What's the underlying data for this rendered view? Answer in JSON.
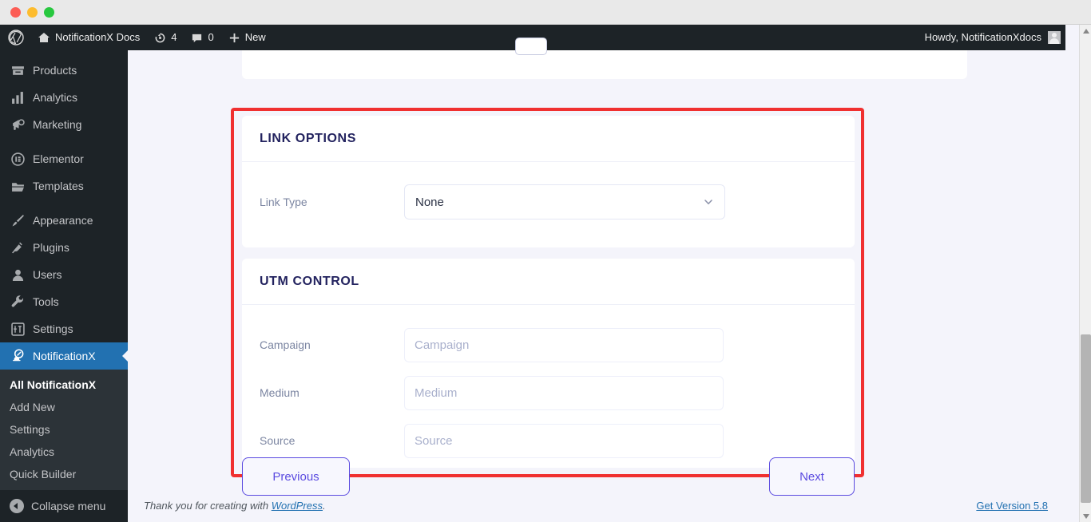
{
  "window": {
    "traffic_lights": [
      "close",
      "minimize",
      "maximize"
    ]
  },
  "adminbar": {
    "logo_icon": "wordpress-logo-icon",
    "site_icon": "home-icon",
    "site_name": "NotificationX Docs",
    "updates_icon": "updates-icon",
    "updates_count": "4",
    "comments_icon": "comment-bubble-icon",
    "comments_count": "0",
    "new_icon": "plus-icon",
    "new_label": "New",
    "howdy": "Howdy, NotificationXdocs",
    "avatar_icon": "user-avatar-icon"
  },
  "sidebar": {
    "items": [
      {
        "label": "Products",
        "icon": "products-icon",
        "active": false
      },
      {
        "label": "Analytics",
        "icon": "chart-bars-icon",
        "active": false
      },
      {
        "label": "Marketing",
        "icon": "megaphone-icon",
        "active": false
      },
      {
        "label": "Elementor",
        "icon": "elementor-icon",
        "active": false
      },
      {
        "label": "Templates",
        "icon": "folder-icon",
        "active": false
      },
      {
        "label": "Appearance",
        "icon": "paintbrush-icon",
        "active": false
      },
      {
        "label": "Plugins",
        "icon": "plug-icon",
        "active": false
      },
      {
        "label": "Users",
        "icon": "user-icon",
        "active": false
      },
      {
        "label": "Tools",
        "icon": "wrench-icon",
        "active": false
      },
      {
        "label": "Settings",
        "icon": "sliders-icon",
        "active": false
      },
      {
        "label": "NotificationX",
        "icon": "notificationx-bell-icon",
        "active": true
      }
    ],
    "submenu": [
      {
        "label": "All NotificationX",
        "current": true
      },
      {
        "label": "Add New",
        "current": false
      },
      {
        "label": "Settings",
        "current": false
      },
      {
        "label": "Analytics",
        "current": false
      },
      {
        "label": "Quick Builder",
        "current": false
      }
    ],
    "collapse_label": "Collapse menu",
    "collapse_icon": "collapse-arrow-icon",
    "active_color": "#2271b1"
  },
  "main": {
    "highlight_color": "#f03030",
    "link_options": {
      "title": "LINK OPTIONS",
      "link_type_label": "Link Type",
      "link_type_value": "None",
      "chevron_icon": "chevron-down-icon"
    },
    "utm_control": {
      "title": "UTM CONTROL",
      "fields": [
        {
          "label": "Campaign",
          "value": "",
          "placeholder": "Campaign"
        },
        {
          "label": "Medium",
          "value": "",
          "placeholder": "Medium"
        },
        {
          "label": "Source",
          "value": "",
          "placeholder": "Source"
        }
      ]
    },
    "nav": {
      "previous_label": "Previous",
      "next_label": "Next",
      "accent_color": "#5b4be0"
    }
  },
  "footer": {
    "thanks_prefix": "Thank you for creating with ",
    "wordpress_link": "WordPress",
    "thanks_suffix": ".",
    "version_link": "Get Version 5.8"
  },
  "scrollbar": {
    "up_icon": "scroll-up-arrow-icon",
    "down_icon": "scroll-down-arrow-icon"
  }
}
